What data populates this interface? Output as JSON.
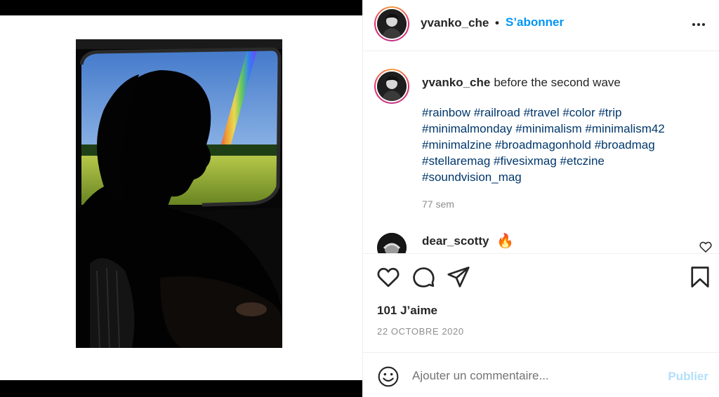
{
  "post": {
    "username": "yvanko_che",
    "separator": "•",
    "follow_label": "S’abonner",
    "more_icon": "more-horizontal-icon",
    "caption_text": "before the second wave",
    "hashtags": "#rainbow #railroad #travel #color #trip #minimalmonday #minimalism #minimalism42 #minimalzine #broadmagonhold #broadmag #stellaremag #fivesixmag #etczine #soundvision_mag",
    "time_ago": "77 sem",
    "likes": "101 J’aime",
    "date": "22 OCTOBRE 2020"
  },
  "comments": [
    {
      "username": "dear_scotty",
      "text": "🔥"
    }
  ],
  "actions": {
    "like_icon": "heart-icon",
    "comment_icon": "comment-bubble-icon",
    "share_icon": "paper-plane-icon",
    "save_icon": "bookmark-icon"
  },
  "comment_box": {
    "placeholder": "Ajouter un commentaire...",
    "publish_label": "Publier",
    "emoji_icon": "smiley-icon"
  },
  "colors": {
    "accent": "#0095f6",
    "hashtag": "#00376b",
    "muted": "#8e8e8e",
    "publish_disabled": "#b2dffc"
  }
}
